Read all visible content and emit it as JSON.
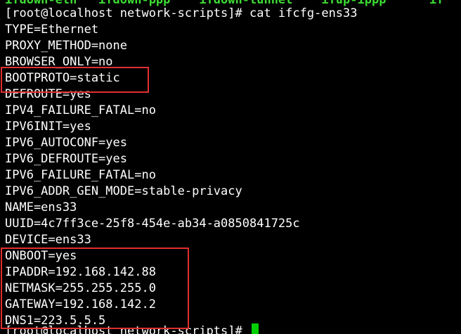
{
  "terminal": {
    "top_partial_line": "ifdown-eth   ifdown-ppp    ifdown-tunnel    ifup-ippp      if",
    "prompt_command": "[root@localhost network-scripts]# cat ifcfg-ens33",
    "config_lines": [
      "TYPE=Ethernet",
      "PROXY_METHOD=none",
      "BROWSER_ONLY=no",
      "BOOTPROTO=static",
      "DEFROUTE=yes",
      "IPV4_FAILURE_FATAL=no",
      "IPV6INIT=yes",
      "IPV6_AUTOCONF=yes",
      "IPV6_DEFROUTE=yes",
      "IPV6_FAILURE_FATAL=no",
      "IPV6_ADDR_GEN_MODE=stable-privacy",
      "NAME=ens33",
      "UUID=4c7ff3ce-25f8-454e-ab34-a0850841725c",
      "DEVICE=ens33",
      "ONBOOT=yes",
      "IPADDR=192.168.142.88",
      "NETMASK=255.255.255.0",
      "GATEWAY=192.168.142.2",
      "DNS1=223.5.5.5"
    ],
    "bottom_prompt": "[root@localhost network-scripts]# "
  },
  "colors": {
    "background": "#000000",
    "text": "#ffffff",
    "top_partial_text": "#3ddc33",
    "cursor": "#00d000",
    "highlight_border": "#e0302f"
  }
}
